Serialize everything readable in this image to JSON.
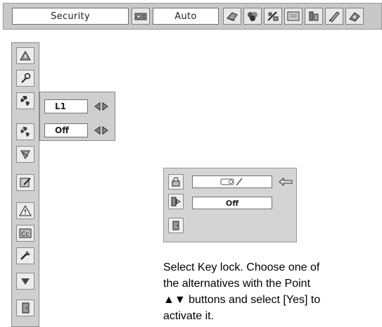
{
  "topbar": {
    "title": "Security",
    "mode": "Auto",
    "icons": [
      "projector-icon",
      "monitor-icon",
      "color-icon",
      "image-icon",
      "screen-icon",
      "setting-icon",
      "pen-icon",
      "gear-icon"
    ]
  },
  "sidebar": {
    "icons": [
      "input-icon",
      "wrench-icon",
      "fan-auto-icon",
      "fan-icon",
      "lamp-icon",
      "note-icon",
      "warning-icon",
      "closed-caption-icon",
      "tools-icon",
      "down-arrow-icon",
      "exit-icon"
    ]
  },
  "submenu": {
    "row1_value": "L1",
    "row2_value": "Off"
  },
  "keylock_panel": {
    "row1_value": "",
    "row2_value": "Off"
  },
  "instructions": {
    "line1": "Select Key lock.  Choose one of",
    "line2": "the alternatives with the Point",
    "line3": "▲▼ buttons and select [Yes] to",
    "line4": "activate it."
  }
}
